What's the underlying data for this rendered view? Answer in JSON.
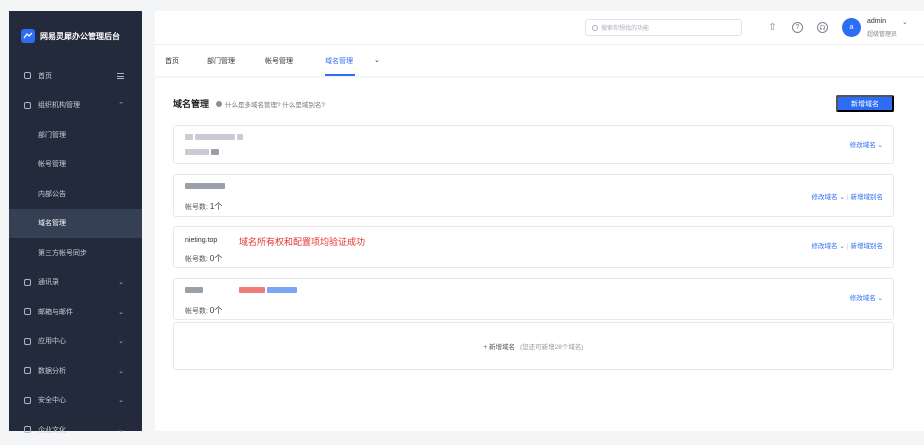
{
  "app": {
    "title": "网易灵犀办公管理后台"
  },
  "sidebar": {
    "items": [
      {
        "label": "首页"
      },
      {
        "label": "组织机构管理"
      },
      {
        "label": "部门管理"
      },
      {
        "label": "帐号管理"
      },
      {
        "label": "内部公告"
      },
      {
        "label": "域名管理"
      },
      {
        "label": "第三方帐号同步"
      },
      {
        "label": "通讯录"
      },
      {
        "label": "邮箱与邮件"
      },
      {
        "label": "应用中心"
      },
      {
        "label": "数据分析"
      },
      {
        "label": "安全中心"
      },
      {
        "label": "企业文化"
      }
    ]
  },
  "topbar": {
    "search_placeholder": "搜索你想找的功能",
    "user": {
      "avatar": "a",
      "name": "admin",
      "role": "超级管理员"
    }
  },
  "tabs": [
    {
      "label": "首页"
    },
    {
      "label": "部门管理"
    },
    {
      "label": "帐号管理"
    },
    {
      "label": "域名管理"
    }
  ],
  "main": {
    "title": "域名管理",
    "help": "什么是多域名管理? 什么是域别名?",
    "add_button": "新增域名",
    "cards": [
      {
        "actions": [
          "修改域名"
        ]
      },
      {
        "count_label": "帐号数:",
        "count": "1个",
        "actions": [
          "修改域名",
          "新增域别名"
        ]
      },
      {
        "name": "nieting.top",
        "count_label": "帐号数:",
        "count": "0个",
        "actions": [
          "修改域名",
          "新增域别名"
        ],
        "annotation": "域名所有权和配置项均验证成功"
      },
      {
        "count_label": "帐号数:",
        "count": "0个",
        "actions": [
          "修改域名"
        ]
      }
    ],
    "add_domain": {
      "label": "+ 新增域名",
      "hint": "(您还可新增28个域名)"
    }
  },
  "colors": {
    "accent": "#2d6df6",
    "sidebar_bg": "#222a3b",
    "annotation": "#e6312d"
  }
}
